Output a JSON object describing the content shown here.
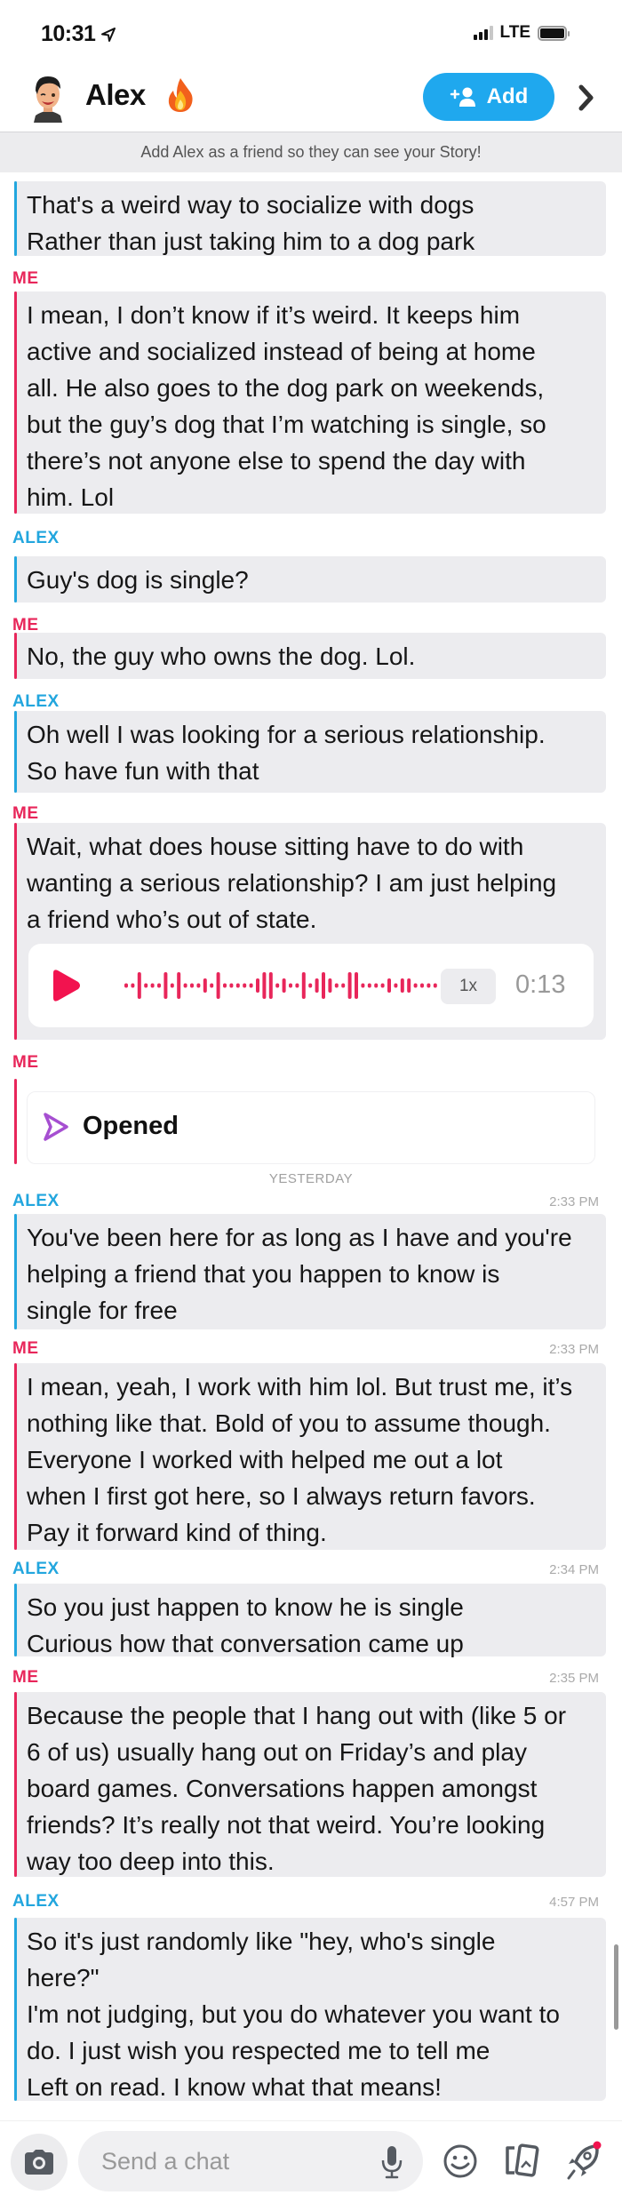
{
  "status_bar": {
    "time": "10:31",
    "network": "LTE",
    "location_icon": "location-arrow-icon",
    "signal_icon": "signal-bars-icon",
    "battery_icon": "battery-icon"
  },
  "header": {
    "contact_name": "Alex",
    "streak_icon": "fire-emoji",
    "add_button_label": "Add",
    "add_button_icon": "add-friend-icon",
    "more_icon": "chevron-right-icon",
    "accent_color": "#1fa8ee"
  },
  "banner": {
    "text": "Add Alex as a friend so they can see your Story!"
  },
  "colors": {
    "alex": "#22a6de",
    "me": "#e8265a",
    "bubble_bg": "#ececef",
    "opened_icon": "#a64fd1"
  },
  "messages": [
    {
      "sender": "",
      "timestamp": "",
      "lines": [
        "That's a weird way to socialize with dogs",
        "Rather than just taking him to a dog park"
      ]
    },
    {
      "sender": "ME",
      "timestamp": "",
      "lines": [
        "I mean, I don’t know if it’s weird. It keeps him",
        "active and socialized instead of being at home",
        "all. He also goes to the dog park on weekends,",
        "but the guy’s dog that I’m watching is single, so",
        "there’s not anyone else to spend the day with",
        "him. Lol"
      ]
    },
    {
      "sender": "ALEX",
      "timestamp": "",
      "lines": [
        "Guy's dog is single?"
      ]
    },
    {
      "sender": "ME",
      "timestamp": "",
      "lines": [
        "No, the guy who owns the dog. Lol."
      ]
    },
    {
      "sender": "ALEX",
      "timestamp": "",
      "lines": [
        "Oh well I was looking for a serious relationship.",
        "So have fun with that"
      ]
    },
    {
      "sender": "ME",
      "timestamp": "",
      "lines": [
        "Wait, what does house sitting have to do with",
        "wanting a serious relationship? I am just helping",
        "a friend who’s out of state."
      ],
      "voice_note": {
        "speed": "1x",
        "duration": "0:13"
      }
    },
    {
      "sender": "ME",
      "timestamp": "",
      "status": "Opened"
    },
    {
      "sender": "ALEX",
      "timestamp": "2:33 PM",
      "lines": [
        "You've been here for as long as I have and you're",
        "helping a friend that you happen to know is",
        "single for free"
      ]
    },
    {
      "sender": "ME",
      "timestamp": "2:33 PM",
      "lines": [
        "I mean, yeah, I work with him lol. But trust me, it’s",
        "nothing like that. Bold of you to assume though.",
        "Everyone I worked with helped me out a lot",
        "when I first got here, so I always return favors.",
        "Pay it forward kind of thing."
      ]
    },
    {
      "sender": "ALEX",
      "timestamp": "2:34 PM",
      "lines": [
        "So you just happen to know he is single",
        "Curious how that conversation came up"
      ]
    },
    {
      "sender": "ME",
      "timestamp": "2:35 PM",
      "lines": [
        "Because the people that I hang out with (like 5 or",
        "6 of us) usually hang out on Friday’s and play",
        "board games. Conversations happen amongst",
        "friends? It’s really not that weird. You’re looking",
        "way too deep into this."
      ]
    },
    {
      "sender": "ALEX",
      "timestamp": "4:57 PM",
      "lines": [
        "So it's just randomly like \"hey, who's single",
        "here?\"",
        "I'm not judging, but you do whatever you want to",
        "do. I just wish you respected me to tell me",
        "Left on read. I know what that means!"
      ]
    }
  ],
  "day_separator": "YESTERDAY",
  "composer": {
    "placeholder": "Send a chat",
    "value": "",
    "icons": [
      "camera-icon",
      "microphone-icon",
      "smiley-icon",
      "cards-icon",
      "rocket-icon"
    ]
  }
}
